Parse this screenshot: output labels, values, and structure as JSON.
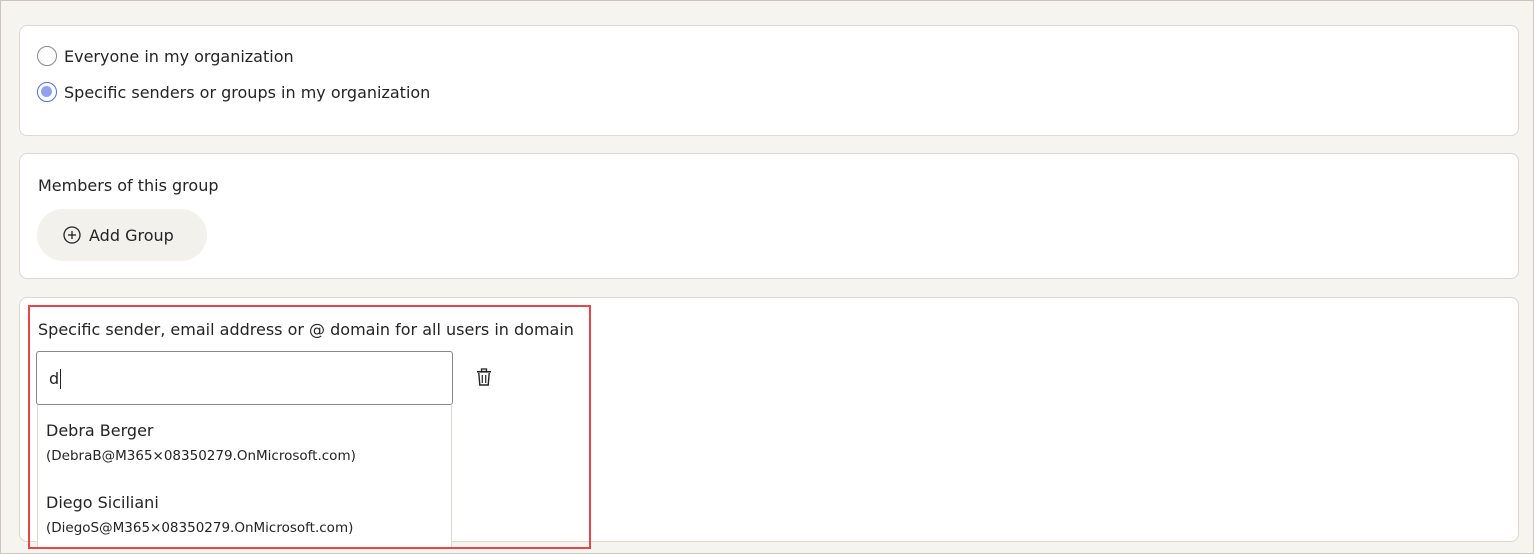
{
  "audience": {
    "options": [
      {
        "label": "Everyone in my organization",
        "selected": false
      },
      {
        "label": "Specific senders or groups in my organization",
        "selected": true
      }
    ]
  },
  "group_section": {
    "title": "Members of this group",
    "add_button_label": "Add Group",
    "add_icon": "plus-circle-icon"
  },
  "sender_section": {
    "title": "Specific sender, email address or @ domain for all users in domain",
    "input_value": "d",
    "input_placeholder": "",
    "delete_icon": "trash-icon",
    "suggestions": [
      {
        "name": "Debra Berger",
        "email": "(DebraB@M365×08350279.OnMicrosoft.com)"
      },
      {
        "name": "Diego Siciliani",
        "email": "(DiegoS@M365×08350279.OnMicrosoft.com)"
      }
    ]
  },
  "colors": {
    "page_background": "#f6f4ef",
    "card_background": "#ffffff",
    "radio_selected": "#4f6bed",
    "highlight_border": "#e5464a"
  }
}
